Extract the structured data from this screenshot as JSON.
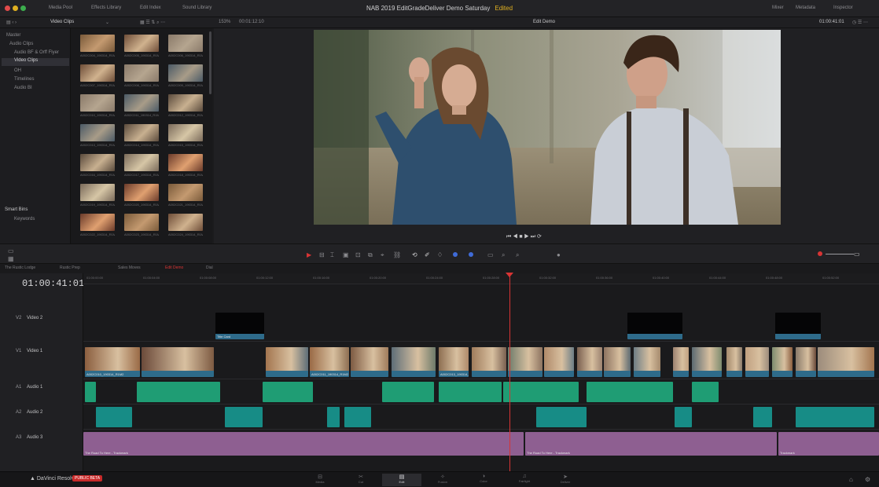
{
  "window": {
    "title": "NAB 2019 EditGradeDeliver Demo Saturday",
    "edited": "Edited",
    "menu": [
      "Media Pool",
      "Effects Library",
      "Edit Index",
      "Sound Library"
    ],
    "right_menu": [
      "Mixer",
      "Metadata",
      "Inspector"
    ]
  },
  "media": {
    "bin_title": "Video Clips",
    "bins": [
      "Master",
      "Audio Clips",
      "Audio BF & Orff Flyer",
      "Video Clips",
      "OH",
      "Timelines",
      "Audio BI"
    ],
    "smart_bins_label": "Smart Bins",
    "smart_bins": [
      "Keywords"
    ],
    "thumbnails": [
      [
        "A002C004_190314_R1M2",
        "A002C005_190314_R1M2",
        "A002C006_190314_R1M2"
      ],
      [
        "A002C007_190314_R1M2",
        "A002C008_190314_R1M2",
        "A002C009_190314_R1M2"
      ],
      [
        "A002C010_190314_R1M2",
        "A002C011_190314_R1M2",
        "A002C012_190314_R1M2"
      ],
      [
        "A002C013_190314_R1M2",
        "A002C014_190314_R1M2",
        "A002C015_190314_R1M2"
      ],
      [
        "A002C016_190314_R1M2",
        "A002C017_190314_R1M2",
        "A002C018_190314_R1M2"
      ],
      [
        "A002C019_190314_R1M2",
        "A002C020_190314_R1M2",
        "A002C021_190314_R1M2"
      ],
      [
        "A002C022_190314_R1M2",
        "A002C023_190314_R1M2",
        "A002C024_190314_R1M2"
      ]
    ]
  },
  "viewer": {
    "zoom": "153%",
    "source_timecode": "00:01:12:10",
    "timeline_name": "Edit Demo",
    "timecode": "01:00:41:01"
  },
  "timeline": {
    "timecode": "01:00:41:01",
    "tabs": [
      "The Rustic Lodge",
      "Rustic Prep",
      "Sales Moves",
      "Edit Demo",
      "Dial"
    ],
    "ruler": [
      "01:00:00:00",
      "01:00:04:00",
      "01:00:08:00",
      "01:00:12:00",
      "01:00:16:00",
      "01:00:20:00",
      "01:00:24:00",
      "01:00:28:00",
      "01:00:32:00",
      "01:00:36:00",
      "01:00:40:00",
      "01:00:44:00",
      "01:00:48:00",
      "01:00:52:00"
    ],
    "tracks": [
      "V2",
      "Video 2",
      "V1",
      "Video 1",
      "A1",
      "Audio 1",
      "A2",
      "Audio 2",
      "A3",
      "Audio 3"
    ],
    "clip_labels": [
      "Title Card",
      "A002C010_190314_R1M2",
      "A002C011_190314_R1M2",
      "A002C013_190314_R1M2",
      "The Road To Here - Trackmark",
      "The Road To Here - Trackmark",
      "Trackmark"
    ]
  },
  "bottom": {
    "app": "DaVinci Resolve 17",
    "badge": "PUBLIC BETA",
    "pages": [
      "Media",
      "Cut",
      "Edit",
      "Fusion",
      "Color",
      "Fairlight",
      "Deliver"
    ]
  }
}
